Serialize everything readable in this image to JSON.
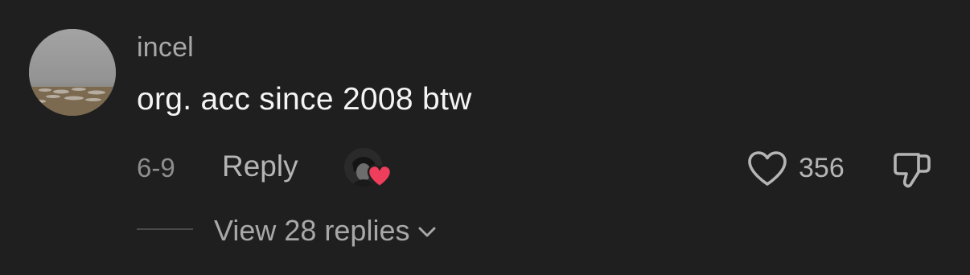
{
  "comment": {
    "username": "incel",
    "text": "org. acc since 2008 btw",
    "date": "6-9",
    "reply_label": "Reply",
    "like_count": "356",
    "view_replies_label": "View 28 replies",
    "creator_liked": true
  },
  "icons": {
    "avatar": "user-avatar",
    "creator_avatar": "creator-avatar",
    "creator_heart": "heart-filled-icon",
    "like": "heart-outline-icon",
    "dislike": "thumbs-down-icon",
    "chevron": "chevron-down-icon"
  },
  "colors": {
    "background": "#1f1f1f",
    "heart_red": "#ef3e5c",
    "secondary_text": "#a8a8a8"
  }
}
